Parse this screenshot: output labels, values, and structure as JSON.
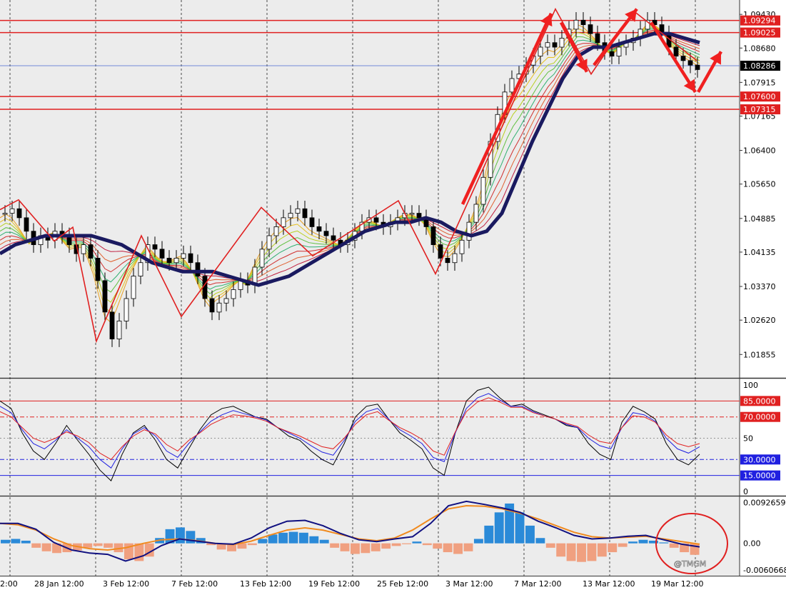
{
  "chart_data": [
    {
      "type": "candlestick",
      "panel": "price",
      "y_tick_labels": [
        "1.09430",
        "1.08680",
        "1.07915",
        "1.07165",
        "1.06400",
        "1.05650",
        "1.04885",
        "1.04135",
        "1.03370",
        "1.02620",
        "1.01855"
      ],
      "ylim": [
        1.0135,
        1.0975
      ],
      "current_price": {
        "value": 1.08286,
        "label": "1.08286"
      },
      "horizontal_lines": [
        {
          "value": 1.09294,
          "label": "1.09294"
        },
        {
          "value": 1.09025,
          "label": "1.09025"
        },
        {
          "value": 1.076,
          "label": "1.07600"
        },
        {
          "value": 1.07315,
          "label": "1.07315"
        }
      ],
      "approx_close_path": [
        1.05,
        1.051,
        1.049,
        1.046,
        1.043,
        1.045,
        1.044,
        1.046,
        1.045,
        1.043,
        1.041,
        1.043,
        1.04,
        1.035,
        1.028,
        1.022,
        1.026,
        1.031,
        1.036,
        1.039,
        1.043,
        1.042,
        1.04,
        1.039,
        1.04,
        1.041,
        1.039,
        1.036,
        1.031,
        1.028,
        1.03,
        1.031,
        1.033,
        1.035,
        1.034,
        1.038,
        1.042,
        1.045,
        1.047,
        1.049,
        1.05,
        1.051,
        1.049,
        1.047,
        1.046,
        1.045,
        1.044,
        1.043,
        1.044,
        1.046,
        1.048,
        1.049,
        1.048,
        1.047,
        1.048,
        1.049,
        1.05,
        1.05,
        1.049,
        1.047,
        1.043,
        1.04,
        1.039,
        1.041,
        1.044,
        1.048,
        1.052,
        1.058,
        1.066,
        1.072,
        1.077,
        1.08,
        1.081,
        1.083,
        1.085,
        1.087,
        1.088,
        1.087,
        1.089,
        1.091,
        1.093,
        1.092,
        1.09,
        1.088,
        1.086,
        1.085,
        1.087,
        1.088,
        1.089,
        1.091,
        1.093,
        1.092,
        1.09,
        1.087,
        1.085,
        1.084,
        1.083,
        1.082
      ],
      "zigzag": [
        1.0508,
        1.053,
        1.0438,
        1.0469,
        1.0215,
        1.045,
        1.027,
        1.0513,
        1.0405,
        1.0528,
        1.0365,
        1.0955,
        1.081,
        1.095,
        1.084
      ],
      "moving_average": [
        1.041,
        1.043,
        1.044,
        1.045,
        1.045,
        1.045,
        1.045,
        1.044,
        1.043,
        1.041,
        1.039,
        1.038,
        1.037,
        1.037,
        1.037,
        1.036,
        1.035,
        1.034,
        1.035,
        1.036,
        1.038,
        1.04,
        1.042,
        1.044,
        1.046,
        1.047,
        1.048,
        1.048,
        1.049,
        1.048,
        1.046,
        1.045,
        1.046,
        1.05,
        1.058,
        1.066,
        1.073,
        1.08,
        1.085,
        1.087,
        1.087,
        1.088,
        1.089,
        1.09,
        1.09,
        1.089,
        1.088
      ],
      "arrows": [
        "up",
        "down",
        "up",
        "down",
        "up"
      ]
    },
    {
      "type": "line",
      "panel": "oscillator",
      "y_tick_labels": [
        "100",
        "50",
        "0"
      ],
      "ylim": [
        0,
        100
      ],
      "levels": [
        {
          "value": 85,
          "label": "85.0000",
          "color": "#e02020"
        },
        {
          "value": 70,
          "label": "70.0000",
          "color": "#e02020"
        },
        {
          "value": 30,
          "label": "30.0000",
          "color": "#2020e0"
        },
        {
          "value": 15,
          "label": "15.0000",
          "color": "#2020e0"
        }
      ],
      "series": [
        {
          "color": "#000000",
          "values": [
            85,
            78,
            55,
            38,
            30,
            45,
            62,
            48,
            35,
            20,
            10,
            35,
            55,
            62,
            48,
            30,
            22,
            40,
            58,
            72,
            78,
            80,
            75,
            70,
            68,
            60,
            52,
            48,
            38,
            30,
            25,
            45,
            70,
            80,
            82,
            68,
            55,
            48,
            40,
            22,
            15,
            55,
            85,
            95,
            98,
            88,
            80,
            82,
            76,
            72,
            68,
            62,
            60,
            45,
            35,
            30,
            65,
            80,
            75,
            68,
            45,
            30,
            25,
            35
          ]
        },
        {
          "color": "#2020e0",
          "values": [
            80,
            74,
            58,
            45,
            40,
            48,
            58,
            50,
            42,
            30,
            22,
            40,
            54,
            60,
            52,
            38,
            32,
            45,
            56,
            66,
            72,
            76,
            73,
            70,
            67,
            60,
            55,
            50,
            43,
            37,
            34,
            48,
            66,
            75,
            78,
            68,
            58,
            52,
            45,
            32,
            28,
            55,
            78,
            88,
            92,
            86,
            80,
            80,
            75,
            71,
            68,
            63,
            60,
            50,
            43,
            40,
            60,
            74,
            72,
            66,
            50,
            40,
            36,
            42
          ]
        },
        {
          "color": "#e02020",
          "values": [
            75,
            70,
            60,
            50,
            46,
            50,
            56,
            52,
            46,
            36,
            30,
            42,
            52,
            58,
            54,
            44,
            38,
            48,
            55,
            63,
            68,
            72,
            71,
            69,
            66,
            60,
            56,
            52,
            47,
            42,
            40,
            50,
            63,
            72,
            75,
            67,
            60,
            55,
            49,
            38,
            34,
            56,
            75,
            84,
            88,
            84,
            79,
            79,
            74,
            71,
            68,
            64,
            61,
            53,
            47,
            45,
            60,
            71,
            70,
            65,
            53,
            45,
            42,
            45
          ]
        }
      ]
    },
    {
      "type": "bar",
      "panel": "macd",
      "y_tick_labels": [
        "0.0092659",
        "0.00",
        "-0.0060668"
      ],
      "ylim": [
        -0.007,
        0.0098
      ],
      "histogram": [
        0.0008,
        0.001,
        0.0006,
        -0.001,
        -0.0018,
        -0.0022,
        -0.002,
        -0.0016,
        -0.001,
        -0.0006,
        -0.001,
        -0.002,
        -0.0036,
        -0.004,
        -0.003,
        0.0012,
        0.0032,
        0.0036,
        0.0028,
        0.0012,
        -0.0004,
        -0.0014,
        -0.0018,
        -0.0012,
        -0.0004,
        0.001,
        0.002,
        0.0024,
        0.0026,
        0.0024,
        0.0016,
        0.0008,
        -0.001,
        -0.0018,
        -0.0024,
        -0.0022,
        -0.0018,
        -0.0012,
        -0.0006,
        -0.0002,
        0.0004,
        -0.0004,
        -0.0012,
        -0.002,
        -0.0024,
        -0.0018,
        0.001,
        0.004,
        0.007,
        0.009,
        0.007,
        0.004,
        0.0012,
        -0.001,
        -0.003,
        -0.004,
        -0.0042,
        -0.004,
        -0.003,
        -0.002,
        -0.0008,
        0.0004,
        0.0008,
        0.0006,
        0.0002,
        -0.001,
        -0.002,
        -0.0026
      ],
      "series": [
        {
          "color": "#f08a1e",
          "values": [
            0.0045,
            0.0042,
            0.003,
            0.001,
            -0.0005,
            -0.0012,
            -0.0015,
            -0.001,
            0.0,
            0.0008,
            0.001,
            0.0006,
            0.0,
            -0.0003,
            0.0005,
            0.0018,
            0.003,
            0.0035,
            0.003,
            0.002,
            0.001,
            0.0006,
            0.0012,
            0.003,
            0.0055,
            0.0078,
            0.0085,
            0.0084,
            0.0078,
            0.0068,
            0.0055,
            0.004,
            0.0025,
            0.0015,
            0.0012,
            0.0014,
            0.0016,
            0.001,
            0.0004,
            -0.0002
          ]
        },
        {
          "color": "#101080",
          "values": [
            0.0045,
            0.0045,
            0.0032,
            0.0002,
            -0.0015,
            -0.0022,
            -0.0025,
            -0.004,
            -0.0028,
            -0.0005,
            0.001,
            0.0005,
            0.0,
            -0.0002,
            0.0012,
            0.0035,
            0.005,
            0.0052,
            0.004,
            0.0022,
            0.0008,
            0.0004,
            0.001,
            0.0015,
            0.0045,
            0.0085,
            0.0095,
            0.0088,
            0.008,
            0.007,
            0.005,
            0.0035,
            0.0018,
            0.001,
            0.0012,
            0.0016,
            0.0018,
            0.0008,
            -0.0002,
            -0.0008
          ]
        }
      ]
    }
  ],
  "x_labels": [
    "2:00",
    "28 Jan 12:00",
    "3 Feb 12:00",
    "7 Feb 12:00",
    "13 Feb 12:00",
    "19 Feb 12:00",
    "25 Feb 12:00",
    "3 Mar 12:00",
    "7 Mar 12:00",
    "13 Mar 12:00",
    "19 Mar 12:00"
  ],
  "watermark": "@TMGM",
  "colors": {
    "axis_label_red": "#e02020",
    "current_price_label": "#000000",
    "level_blue": "#1a1acc",
    "zigzag": "#e02020",
    "ma_thick": "#1a1a60"
  }
}
